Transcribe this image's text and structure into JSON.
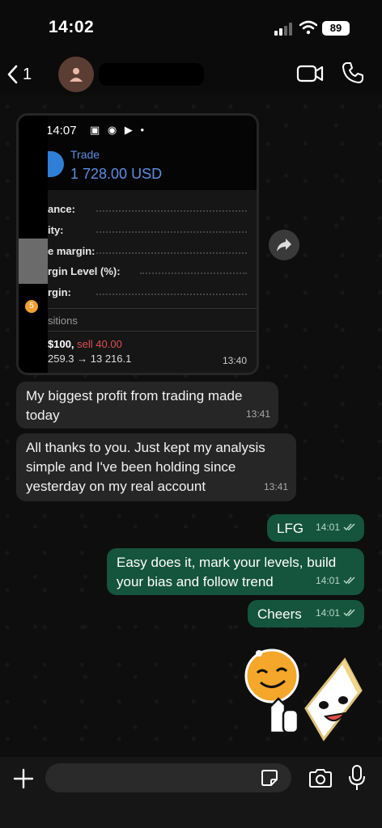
{
  "status_bar": {
    "time": "14:02",
    "battery": "89"
  },
  "header": {
    "back_count": "1"
  },
  "screenshot_message": {
    "time": "13:40",
    "inner": {
      "time": "14:07",
      "status_icons": "▣ ◉ ▶ •",
      "trade_label": "Trade",
      "amount": "1 728.00 USD",
      "rows": [
        "ance:",
        "ity:",
        "e margin:",
        "rgin Level (%):",
        "rgin:"
      ],
      "badge": "5",
      "positions_label": "sitions",
      "position_line_a": "$100,",
      "position_line_b": "sell 40.00",
      "position_line_2": "259.3 → 13 216.1"
    }
  },
  "messages": [
    {
      "text": "My biggest profit from trading made today",
      "time": "13:41",
      "direction": "in"
    },
    {
      "text": "All thanks to you. Just kept my analysis simple and I've been holding since yesterday on my real account",
      "time": "13:41",
      "direction": "in"
    },
    {
      "text": "LFG",
      "time": "14:01",
      "direction": "out"
    },
    {
      "text": "Easy does it, mark your levels, build your bias and follow trend",
      "time": "14:01",
      "direction": "out"
    },
    {
      "text": "Cheers",
      "time": "14:01",
      "direction": "out"
    }
  ],
  "composer": {
    "placeholder": ""
  },
  "colors": {
    "incoming": "#262626",
    "outgoing": "#15543d",
    "accent": "#25d366"
  }
}
